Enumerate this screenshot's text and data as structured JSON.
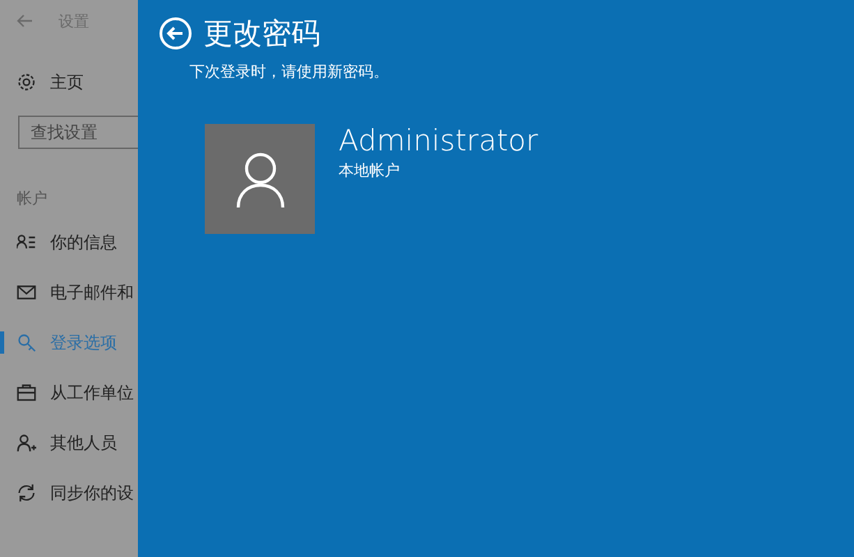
{
  "sidebar": {
    "title": "设置",
    "home": "主页",
    "search": {
      "placeholder": "查找设置"
    },
    "section": "帐户",
    "items": [
      {
        "label": "你的信息",
        "selected": false
      },
      {
        "label": "电子邮件和",
        "selected": false
      },
      {
        "label": "登录选项",
        "selected": true
      },
      {
        "label": "从工作单位",
        "selected": false
      },
      {
        "label": "其他人员",
        "selected": false
      },
      {
        "label": "同步你的设",
        "selected": false
      }
    ]
  },
  "dialog": {
    "title": "更改密码",
    "subtitle": "下次登录时，请使用新密码。",
    "user": {
      "name": "Administrator",
      "type": "本地帐户"
    }
  }
}
